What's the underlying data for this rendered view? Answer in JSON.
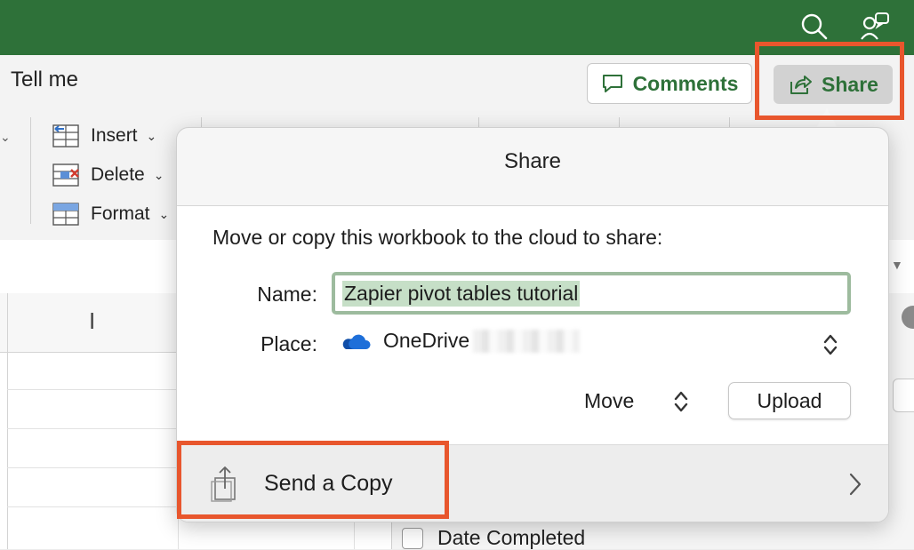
{
  "ribbon": {
    "tell_me": "Tell me",
    "cells": {
      "insert_label": "Insert",
      "delete_label": "Delete",
      "format_label": "Format"
    },
    "comments_label": "Comments",
    "share_label": "Share"
  },
  "sheet": {
    "column_header": "I"
  },
  "share_popover": {
    "title": "Share",
    "message": "Move or copy this workbook to the cloud to share:",
    "name_label": "Name:",
    "name_value": "Zapier pivot tables tutorial",
    "place_label": "Place:",
    "place_value": "OneDrive",
    "move_label": "Move",
    "upload_label": "Upload",
    "send_copy_label": "Send a Copy"
  },
  "side_pane": {
    "date_completed_label": "Date Completed"
  },
  "colors": {
    "excel_green": "#2e7139",
    "highlight_orange": "#e8562d",
    "name_selection": "#c6dfc7",
    "onedrive_blue": "#1e6fd9"
  }
}
